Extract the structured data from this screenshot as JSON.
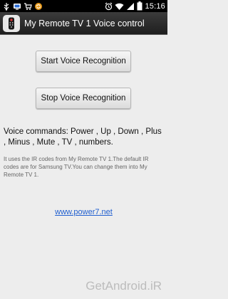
{
  "status_bar": {
    "time": "15:16",
    "left_icons": [
      "usb-icon",
      "tv-icon",
      "cart-icon",
      "sync-icon"
    ],
    "right_icons": [
      "alarm-icon",
      "wifi-icon",
      "signal-icon",
      "battery-icon"
    ]
  },
  "app": {
    "title": "My Remote TV 1 Voice control",
    "icon": "remote-icon"
  },
  "buttons": {
    "start_label": "Start Voice Recognition",
    "stop_label": "Stop Voice Recognition"
  },
  "content": {
    "commands": "Voice commands: Power , Up , Down , Plus , Minus , Mute , TV , numbers.",
    "info": "It uses the IR codes from My Remote TV 1.The default IR codes are for Samsung TV.You can change them into My Remote TV 1.",
    "link": "www.power7.net"
  },
  "watermark": "GetAndroid.iR",
  "colors": {
    "link": "#1f5ecf",
    "title_bar": "#2b2b2b",
    "background": "#ededed"
  }
}
